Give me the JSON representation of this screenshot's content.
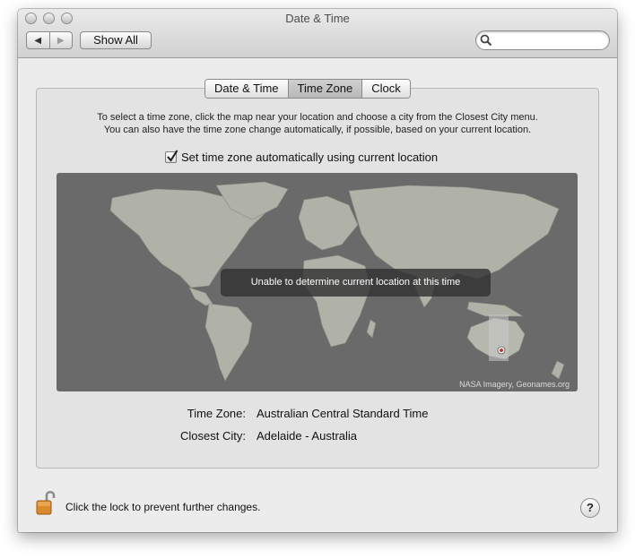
{
  "window": {
    "title": "Date & Time"
  },
  "toolbar": {
    "back_icon": "back-arrow-icon",
    "forward_icon": "forward-arrow-icon",
    "show_all_label": "Show All",
    "search_placeholder": ""
  },
  "tabs": [
    {
      "label": "Date & Time",
      "active": false
    },
    {
      "label": "Time Zone",
      "active": true
    },
    {
      "label": "Clock",
      "active": false
    }
  ],
  "instructions": {
    "line1": "To select a time zone, click the map near your location and choose a city from the Closest City menu.",
    "line2": "You can also have the time zone change automatically, if possible, based on your current location."
  },
  "auto_timezone": {
    "label": "Set time zone automatically using current location",
    "checked": true
  },
  "map": {
    "overlay_message": "Unable to determine current location at this time",
    "credit": "NASA Imagery, Geonames.org"
  },
  "timezone": {
    "label": "Time Zone:",
    "value": "Australian Central Standard Time"
  },
  "closest_city": {
    "label": "Closest City:",
    "value": "Adelaide - Australia"
  },
  "footer": {
    "lock_text": "Click the lock to prevent further changes.",
    "help_label": "?"
  },
  "colors": {
    "map_background": "#6a6a6a",
    "land": "#b7b8ad",
    "selected_zone": "#c9c9c9",
    "location_marker": "#d23030"
  }
}
